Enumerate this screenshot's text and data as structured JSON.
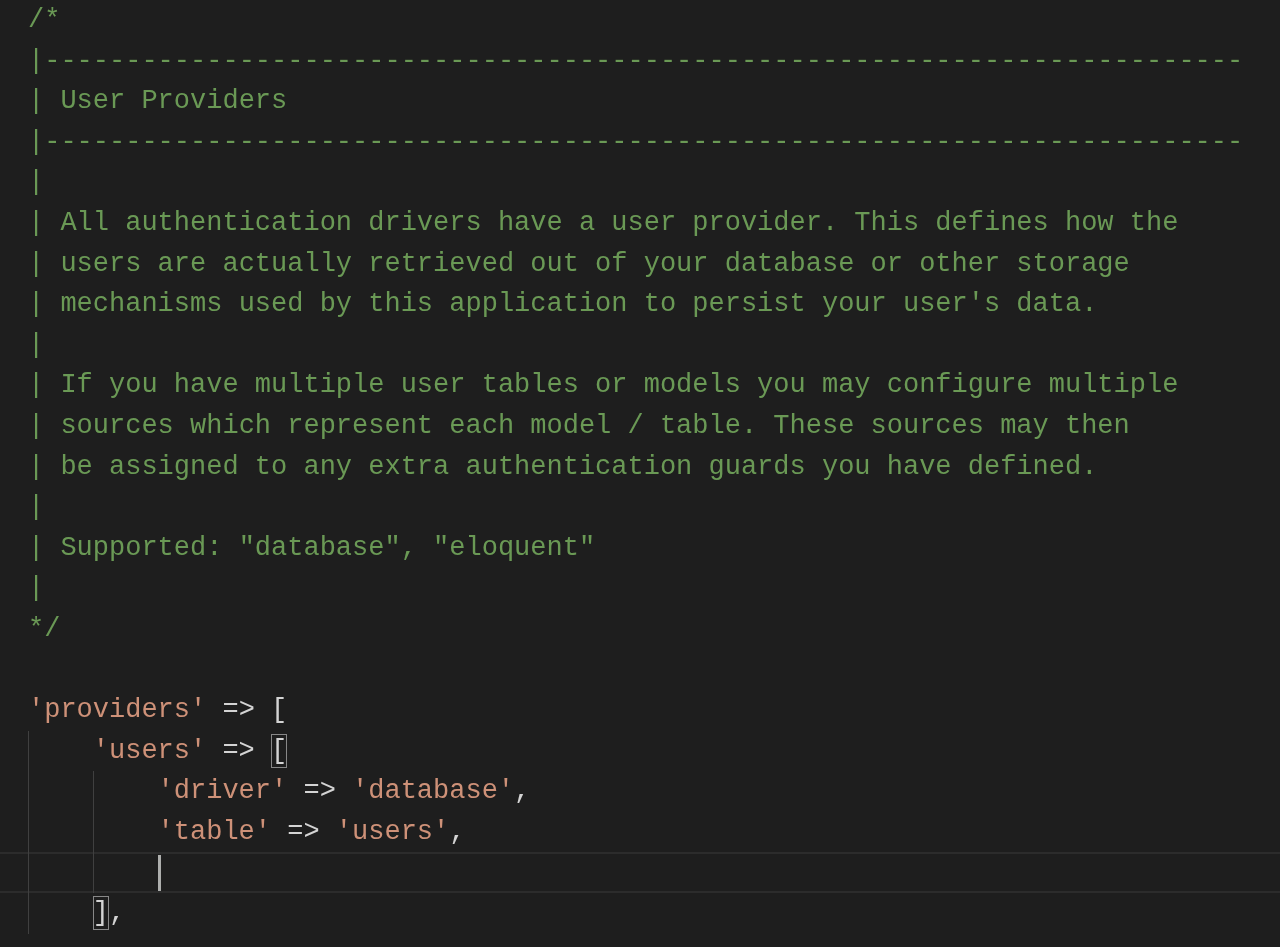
{
  "editor": {
    "lines": [
      {
        "kind": "code",
        "tokens": [
          {
            "kind": "comment",
            "text": "/*"
          }
        ]
      },
      {
        "kind": "code",
        "tokens": [
          {
            "kind": "comment",
            "text": "|--------------------------------------------------------------------------"
          }
        ]
      },
      {
        "kind": "code",
        "tokens": [
          {
            "kind": "comment",
            "text": "| User Providers"
          }
        ]
      },
      {
        "kind": "code",
        "tokens": [
          {
            "kind": "comment",
            "text": "|--------------------------------------------------------------------------"
          }
        ]
      },
      {
        "kind": "code",
        "tokens": [
          {
            "kind": "comment",
            "text": "|"
          }
        ]
      },
      {
        "kind": "code",
        "tokens": [
          {
            "kind": "comment",
            "text": "| All authentication drivers have a user provider. This defines how the"
          }
        ]
      },
      {
        "kind": "code",
        "tokens": [
          {
            "kind": "comment",
            "text": "| users are actually retrieved out of your database or other storage"
          }
        ]
      },
      {
        "kind": "code",
        "tokens": [
          {
            "kind": "comment",
            "text": "| mechanisms used by this application to persist your user's data."
          }
        ]
      },
      {
        "kind": "code",
        "tokens": [
          {
            "kind": "comment",
            "text": "|"
          }
        ]
      },
      {
        "kind": "code",
        "tokens": [
          {
            "kind": "comment",
            "text": "| If you have multiple user tables or models you may configure multiple"
          }
        ]
      },
      {
        "kind": "code",
        "tokens": [
          {
            "kind": "comment",
            "text": "| sources which represent each model / table. These sources may then"
          }
        ]
      },
      {
        "kind": "code",
        "tokens": [
          {
            "kind": "comment",
            "text": "| be assigned to any extra authentication guards you have defined."
          }
        ]
      },
      {
        "kind": "code",
        "tokens": [
          {
            "kind": "comment",
            "text": "|"
          }
        ]
      },
      {
        "kind": "code",
        "tokens": [
          {
            "kind": "comment",
            "text": "| Supported: \"database\", \"eloquent\""
          }
        ]
      },
      {
        "kind": "code",
        "tokens": [
          {
            "kind": "comment",
            "text": "|"
          }
        ]
      },
      {
        "kind": "code",
        "tokens": [
          {
            "kind": "comment",
            "text": "*/"
          }
        ]
      },
      {
        "kind": "blank"
      },
      {
        "kind": "code",
        "tokens": [
          {
            "kind": "string",
            "text": "'providers'"
          },
          {
            "kind": "plain",
            "text": " => ["
          }
        ],
        "children": [
          {
            "kind": "code",
            "tokens": [
              {
                "kind": "string",
                "text": "'users'"
              },
              {
                "kind": "plain",
                "text": " => "
              },
              {
                "kind": "matched_bracket",
                "text": "["
              }
            ],
            "children": [
              {
                "kind": "code",
                "tokens": [
                  {
                    "kind": "string",
                    "text": "'driver'"
                  },
                  {
                    "kind": "plain",
                    "text": " => "
                  },
                  {
                    "kind": "string",
                    "text": "'database'"
                  },
                  {
                    "kind": "plain",
                    "text": ","
                  }
                ]
              },
              {
                "kind": "code",
                "tokens": [
                  {
                    "kind": "string",
                    "text": "'table'"
                  },
                  {
                    "kind": "plain",
                    "text": " => "
                  },
                  {
                    "kind": "string",
                    "text": "'users'"
                  },
                  {
                    "kind": "plain",
                    "text": ","
                  }
                ]
              },
              {
                "kind": "blank",
                "current": true
              }
            ]
          },
          {
            "kind": "code",
            "tokens": [
              {
                "kind": "matched_bracket",
                "text": "]"
              },
              {
                "kind": "plain",
                "text": ","
              }
            ]
          }
        ]
      }
    ]
  }
}
